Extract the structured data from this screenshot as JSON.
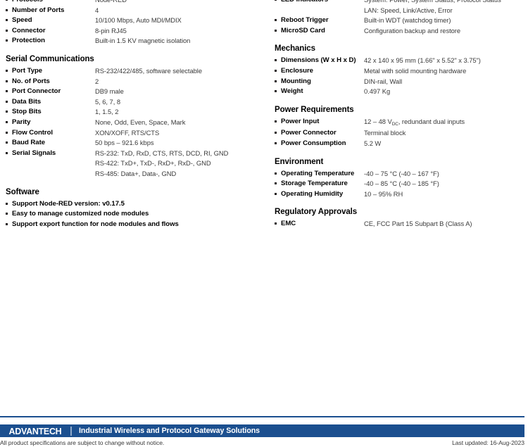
{
  "columns": {
    "left": [
      {
        "id": "network-continued",
        "title": "",
        "show_title": false,
        "first_row_clipped": true,
        "rows": [
          {
            "label": "Protocols",
            "value": "Node-RED"
          },
          {
            "label": "Number of Ports",
            "value": "4"
          },
          {
            "label": "Speed",
            "value": "10/100 Mbps, Auto MDI/MDIX"
          },
          {
            "label": "Connector",
            "value": "8-pin RJ45"
          },
          {
            "label": "Protection",
            "value": "Built-in 1.5 KV magnetic isolation"
          }
        ]
      },
      {
        "id": "serial-communications",
        "title": "Serial Communications",
        "show_title": true,
        "rows": [
          {
            "label": "Port Type",
            "value": "RS-232/422/485, software selectable"
          },
          {
            "label": "No. of Ports",
            "value": "2"
          },
          {
            "label": "Port Connector",
            "value": "DB9 male"
          },
          {
            "label": "Data Bits",
            "value": "5, 6, 7, 8"
          },
          {
            "label": "Stop Bits",
            "value": "1, 1.5, 2"
          },
          {
            "label": "Parity",
            "value": "None, Odd, Even, Space, Mark"
          },
          {
            "label": "Flow Control",
            "value": "XON/XOFF, RTS/CTS"
          },
          {
            "label": "Baud Rate",
            "value": "50 bps – 921.6 kbps"
          },
          {
            "label": "Serial Signals",
            "value_lines": [
              "RS-232: TxD, RxD, CTS, RTS, DCD, RI, GND",
              "RS-422: TxD+, TxD-, RxD+, RxD-, GND",
              "RS-485: Data+, Data-, GND"
            ]
          }
        ]
      },
      {
        "id": "software",
        "title": "Software",
        "show_title": true,
        "bullet_list": true,
        "rows": [
          {
            "label": "Support Node-RED version: v0.17.5"
          },
          {
            "label": "Easy to manage customized node modules"
          },
          {
            "label": "Support export function for node modules and flows"
          }
        ]
      }
    ],
    "right": [
      {
        "id": "system-continued",
        "title": "",
        "show_title": false,
        "first_row_clipped": true,
        "rows": [
          {
            "label": "LED Indicators",
            "value_lines": [
              "System: Power, System Status, Protocol Status",
              "LAN: Speed, Link/Active, Error"
            ]
          },
          {
            "label": "Reboot Trigger",
            "value": "Built-in WDT (watchdog timer)"
          },
          {
            "label": "MicroSD Card",
            "value": "Configuration backup and restore"
          }
        ]
      },
      {
        "id": "mechanics",
        "title": "Mechanics",
        "show_title": true,
        "rows": [
          {
            "label": "Dimensions (W x H x D)",
            "value": "42 x 140 x 95 mm (1.66\" x 5.52\" x 3.75\")"
          },
          {
            "label": "Enclosure",
            "value": "Metal with solid mounting hardware"
          },
          {
            "label": "Mounting",
            "value": "DIN-rail, Wall"
          },
          {
            "label": "Weight",
            "value": "0.497 Kg"
          }
        ]
      },
      {
        "id": "power-requirements",
        "title": "Power Requirements",
        "show_title": true,
        "rows": [
          {
            "label": "Power Input",
            "value_html": "12 – 48 V<sub>DC</sub>, redundant dual inputs"
          },
          {
            "label": "Power Connector",
            "value": "Terminal block"
          },
          {
            "label": "Power Consumption",
            "value": "5.2 W"
          }
        ]
      },
      {
        "id": "environment",
        "title": "Environment",
        "show_title": true,
        "rows": [
          {
            "label": "Operating Temperature",
            "value": "-40 – 75 °C (-40 – 167 °F)"
          },
          {
            "label": "Storage Temperature",
            "value": "-40 – 85 °C (-40 – 185 °F)"
          },
          {
            "label": "Operating Humidity",
            "value": "10 – 95% RH"
          }
        ]
      },
      {
        "id": "regulatory-approvals",
        "title": "Regulatory Approvals",
        "show_title": true,
        "rows": [
          {
            "label": "EMC",
            "value": "CE, FCC Part 15 Subpart B (Class A)"
          }
        ]
      }
    ]
  },
  "footer": {
    "logo_text": "ADVANTECH",
    "title": "Industrial Wireless and Protocol Gateway Solutions",
    "disclaimer": "All product specifications are subject to change without notice.",
    "last_updated": "Last updated: 16-Aug-2023",
    "bar_color": "#1b4f8f",
    "rule_color": "#1b4f8f",
    "logo_separator_color": "#8fa9c9"
  }
}
